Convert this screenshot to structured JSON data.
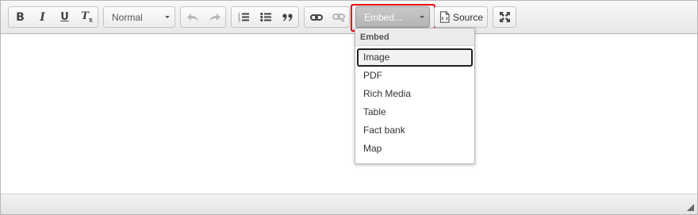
{
  "toolbar": {
    "basicstyles": [
      {
        "icon": "bold-icon",
        "glyph": "B"
      },
      {
        "icon": "italic-icon",
        "glyph": "I"
      },
      {
        "icon": "underline-icon",
        "glyph": "U"
      },
      {
        "icon": "remove-format-icon",
        "glyph": "Tx"
      }
    ],
    "format_combo": {
      "value": "Normal"
    },
    "history": [
      {
        "icon": "undo-icon",
        "disabled": true
      },
      {
        "icon": "redo-icon",
        "disabled": true
      }
    ],
    "lists": [
      {
        "icon": "numbered-list-icon"
      },
      {
        "icon": "bulleted-list-icon"
      },
      {
        "icon": "blockquote-icon"
      }
    ],
    "links": [
      {
        "icon": "link-icon",
        "disabled": false
      },
      {
        "icon": "unlink-icon",
        "disabled": true
      }
    ],
    "embed_combo": {
      "value": "Embed..."
    },
    "source_button": {
      "label": "Source",
      "icon": "source-icon"
    },
    "maximize_button": {
      "icon": "maximize-icon"
    }
  },
  "embed_menu": {
    "header": "Embed",
    "items": [
      "Image",
      "PDF",
      "Rich Media",
      "Table",
      "Fact bank",
      "Map"
    ],
    "focused_index": 0
  },
  "colors": {
    "highlight": "#e8000b",
    "toolbar_bg": "#ececec",
    "border": "#b6b6b6"
  }
}
